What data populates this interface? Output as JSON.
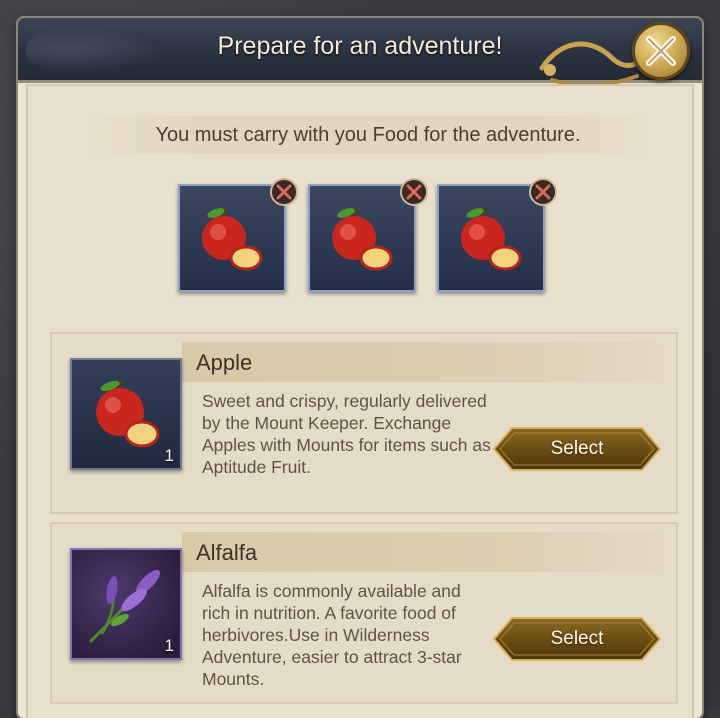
{
  "dialog": {
    "title": "Prepare for an adventure!",
    "instruction": "You must carry with you Food for the adventure."
  },
  "icons": {
    "close": "close-x-icon",
    "remove": "remove-x-icon",
    "apple": "apple-icon",
    "alfalfa": "alfalfa-icon"
  },
  "slots": [
    {
      "item": "Apple"
    },
    {
      "item": "Apple"
    },
    {
      "item": "Apple"
    }
  ],
  "foods": [
    {
      "name": "Apple",
      "description": "Sweet and crispy, regularly delivered by the Mount Keeper. Exchange Apples with Mounts for items such as Aptitude Fruit.",
      "quantity": "1",
      "button": "Select"
    },
    {
      "name": "Alfalfa",
      "description": "Alfalfa is commonly available and rich in nutrition. A favorite food of herbivores.Use in Wilderness Adventure, easier to attract 3-star Mounts.",
      "quantity": "1",
      "button": "Select"
    }
  ],
  "colors": {
    "title_bar": "#2b3342",
    "panel": "#e8dfcc",
    "gold": "#c9a24d"
  }
}
